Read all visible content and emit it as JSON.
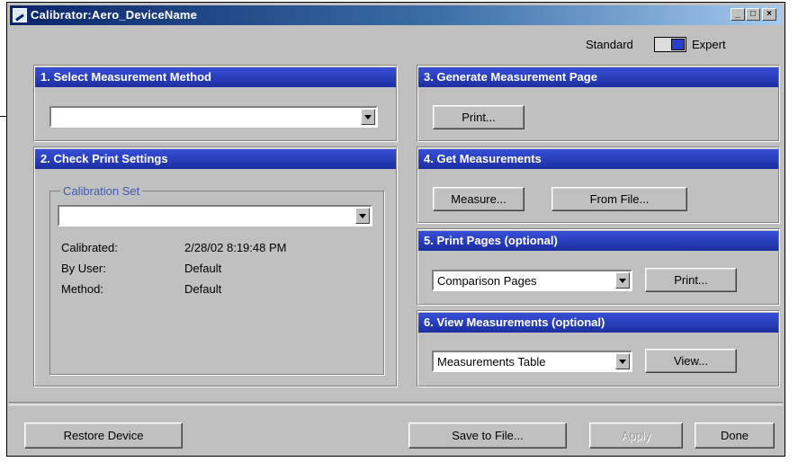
{
  "window": {
    "title": "Calibrator:Aero_DeviceName",
    "controls": {
      "minimize": "_",
      "maximize": "□",
      "close": "×"
    }
  },
  "mode": {
    "standard_label": "Standard",
    "expert_label": "Expert",
    "selected": "Expert"
  },
  "step1": {
    "header": "1. Select Measurement Method",
    "value": ""
  },
  "step2": {
    "header": "2. Check Print Settings",
    "group_label": "Calibration Set",
    "value": "",
    "info": [
      {
        "label": "Calibrated:",
        "value": "2/28/02 8:19:48 PM"
      },
      {
        "label": "By User:",
        "value": "Default"
      },
      {
        "label": "Method:",
        "value": "Default"
      }
    ]
  },
  "step3": {
    "header": "3. Generate Measurement Page",
    "print_label": "Print..."
  },
  "step4": {
    "header": "4. Get Measurements",
    "measure_label": "Measure...",
    "from_file_label": "From File..."
  },
  "step5": {
    "header": "5. Print Pages (optional)",
    "select_value": "Comparison Pages",
    "print_label": "Print..."
  },
  "step6": {
    "header": "6. View Measurements (optional)",
    "select_value": "Measurements Table",
    "view_label": "View..."
  },
  "footer": {
    "restore_label": "Restore Device",
    "save_label": "Save to File...",
    "apply_label": "Apply",
    "done_label": "Done"
  },
  "colors": {
    "header_blue": "#2a3ebe",
    "title_blue": "#0a246a",
    "group_label": "#3c5ab4",
    "face": "#c0c0c0"
  }
}
